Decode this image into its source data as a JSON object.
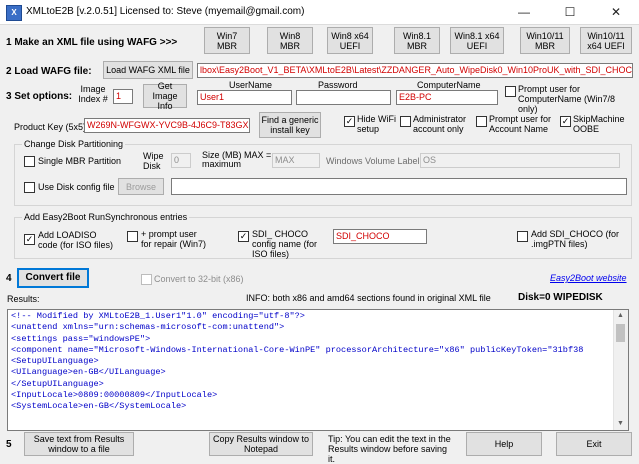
{
  "window": {
    "title": "XMLtoE2B  [v.2.0.51] Licensed to: Steve     (myemail@gmail.com)",
    "controls": {
      "minimize": "—",
      "maximize": "☐",
      "close": "✕"
    }
  },
  "step1": {
    "label": "1  Make an XML file using WAFG >>>",
    "buttons": [
      {
        "line1": "Win7",
        "line2": "MBR"
      },
      {
        "line1": "Win8",
        "line2": "MBR"
      },
      {
        "line1": "Win8 x64",
        "line2": "UEFI"
      },
      {
        "line1": "Win8.1",
        "line2": "MBR"
      },
      {
        "line1": "Win8.1 x64",
        "line2": "UEFI"
      },
      {
        "line1": "Win10/11",
        "line2": "MBR"
      },
      {
        "line1": "Win10/11",
        "line2": "x64 UEFI"
      }
    ]
  },
  "step2": {
    "label": "2  Load WAFG file:",
    "load_button": "Load WAFG XML file",
    "path": "lbox\\Easy2Boot_V1_BETA\\XMLtoE2B\\Latest\\ZZDANGER_Auto_WipeDisk0_Win10ProUK_with_SDI_CHOCO.xml"
  },
  "step3": {
    "label": "3 Set options:",
    "image_index_label": "Image Index #",
    "image_index_value": "1",
    "get_image_info_button": "Get Image Info",
    "username_label": "UserName",
    "username_value": "User1",
    "password_label": "Password",
    "password_value": "",
    "computername_label": "ComputerName",
    "computername_value": "E2B-PC",
    "prompt_computername": "Prompt user for ComputerName (Win7/8 only)",
    "product_key_label": "Product Key (5x5)",
    "product_key_value": "W269N-WFGWX-YVC9B-4J6C9-T83GX",
    "generic_key_button": "Find a generic install key",
    "hide_wifi": "Hide WiFi setup",
    "administrator_account": "Administrator account only",
    "prompt_account": "Prompt user for Account Name",
    "skip_machine_oobe": "SkipMachine OOBE",
    "checked": "✓"
  },
  "partitioning": {
    "group_title": "Change Disk Partitioning",
    "single_mbr": "Single MBR Partition",
    "wipe_disk_label": "Wipe Disk",
    "wipe_disk_value": "0",
    "size_label": "Size (MB) MAX = maximum",
    "size_value": "MAX",
    "volume_label_label": "Windows Volume Label",
    "volume_label_value": "OS",
    "use_disk_config": "Use Disk config file",
    "browse_button": "Browse",
    "disk_config_path": ""
  },
  "runsync": {
    "group_title": "Add Easy2Boot RunSynchronous entries",
    "add_loadiso": "Add LOADISO code (for ISO files)",
    "prompt_repair": "+ prompt user for repair (Win7)",
    "sdi_choco_label": "SDI_ CHOCO config name (for ISO files)",
    "sdi_choco_value": "SDI_CHOCO",
    "add_sdi_choco": "Add SDI_CHOCO (for .imgPTN files)"
  },
  "step4": {
    "label": "4",
    "convert_button": "Convert file",
    "convert_32bit": "Convert to 32-bit (x86)",
    "website_link": "Easy2Boot website"
  },
  "results": {
    "label": "Results:",
    "info": "INFO: both x86 and amd64 sections found in original XML file",
    "disk_status": "Disk=0 WIPEDISK",
    "lines": [
      "<!-- Modified by XMLtoE2B_1.User1\"1.0\" encoding=\"utf-8\"?>",
      "<unattend xmlns=\"urn:schemas-microsoft-com:unattend\">",
      "<settings pass=\"windowsPE\">",
      "<component name=\"Microsoft-Windows-International-Core-WinPE\" processorArchitecture=\"x86\" publicKeyToken=\"31bf38",
      "<SetupUILanguage>",
      "<UILanguage>en-GB</UILanguage>",
      "</SetupUILanguage>",
      "<InputLocale>0809:00000809</InputLocale>",
      "<SystemLocale>en-GB</SystemLocale>"
    ]
  },
  "step5": {
    "label": "5",
    "save_button": "Save text from Results window to a file",
    "copy_button": "Copy Results window to Notepad",
    "tip": "Tip: You can edit the text in the Results window before saving it.",
    "help_button": "Help",
    "exit_button": "Exit"
  }
}
